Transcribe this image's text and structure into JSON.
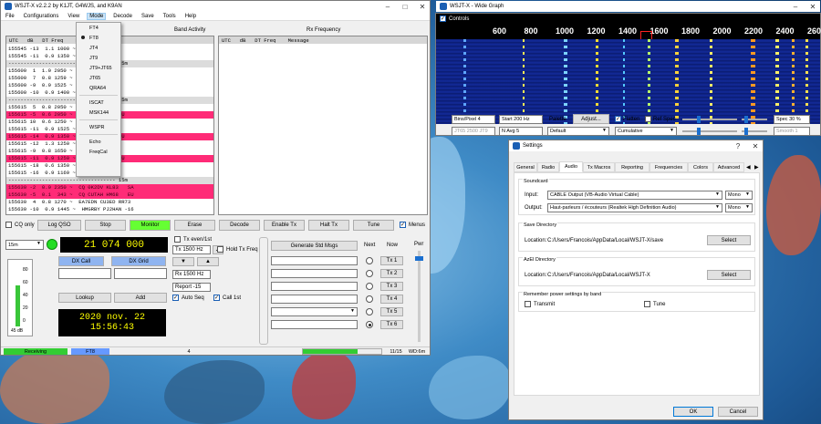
{
  "colors": {
    "cq_highlight": "#ff2b77",
    "monitor_on": "#66ff33",
    "freq_text": "#ffff00",
    "receiving": "#33cc33",
    "mode_badge": "#6699ff"
  },
  "main": {
    "title": "WSJT-X   v2.2.2   by K1JT, G4WJS, and K9AN",
    "menu": [
      "File",
      "Configurations",
      "View",
      "Mode",
      "Decode",
      "Save",
      "Tools",
      "Help"
    ],
    "band_activity_label": "Band Activity",
    "rx_frequency_label": "Rx Frequency",
    "col_header": "UTC   dB   DT Freq    Message",
    "rows": [
      {
        "t": "155545 -13  1.1 1000 ~  TS5OY -11",
        "k": "n"
      },
      {
        "t": "155545 -11  0.9 1350 ~  KA4ACH -15",
        "k": "n"
      },
      {
        "t": "----------------------------------- 15m",
        "k": "sep"
      },
      {
        "t": "155600  1  1.0 2050 ~  HSRSV RR73",
        "k": "n"
      },
      {
        "t": "155600  7  0.8 1259 ~  CU3ED -14",
        "k": "n"
      },
      {
        "t": "155600 -9  0.9 1525 ~  ZJMAN RR73",
        "k": "n"
      },
      {
        "t": "155600 -10  0.9 1400 ~  NGSW RR73",
        "k": "n"
      },
      {
        "t": "----------------------------------- 15m",
        "k": "sep"
      },
      {
        "t": "155615  5  0.8 2050 ~  OG5FI R-13",
        "k": "n"
      },
      {
        "t": "155615 -5  0.6 2050 ~  CQ FK34      EU",
        "k": "cq"
      },
      {
        "t": "155615 10  0.6 1250 ~  CU3ED -14",
        "k": "n"
      },
      {
        "t": "155615 -11  0.9 1525 ~  ZJMAN RR73",
        "k": "n"
      },
      {
        "t": "155615 -14  0.9 1350 ~  CQ IZ8E     EU",
        "k": "cq"
      },
      {
        "t": "155615 -12  1.3 1250 ~  F4JF R-10",
        "k": "n"
      },
      {
        "t": "155615 -9  0.8 1650 ~  PU1JDU -17",
        "k": "n"
      },
      {
        "t": "155615 -11  0.9 1250 ~  CQ 0052     EU",
        "k": "cq"
      },
      {
        "t": "155615 -18  0.6 1350 ~  PY2KC GG64",
        "k": "n"
      },
      {
        "t": "155615 -16  0.9 1169 ~  PU5XRV GG54",
        "k": "n"
      },
      {
        "t": "----------------------------------- 15m",
        "k": "sep"
      },
      {
        "t": "155630 -2  0.9 2350 ~  CQ 0K2DV KL83   SA",
        "k": "cq"
      },
      {
        "t": "155630 -5  0.1  343 ~  CQ CUTAH HM68   EU",
        "k": "cq"
      },
      {
        "t": "155630  4  0.8 1270 ~  EA7EDN CU3ED RR73",
        "k": "n"
      },
      {
        "t": "155630 -10  0.9 1445 ~  HMGRBY PJ2HAN -16",
        "k": "n"
      }
    ],
    "mode_menu": [
      {
        "label": "FT4",
        "selected": false
      },
      {
        "label": "FT8",
        "selected": true
      },
      {
        "label": "JT4",
        "selected": false
      },
      {
        "label": "JT9",
        "selected": false
      },
      {
        "label": "JT9+JT65",
        "selected": false
      },
      {
        "label": "JT65",
        "selected": false
      },
      {
        "label": "QRA64",
        "selected": false
      },
      {
        "label": "ISCAT",
        "selected": false
      },
      {
        "label": "MSK144",
        "selected": false
      },
      {
        "label": "WSPR",
        "selected": false
      },
      {
        "label": "Echo",
        "selected": false
      },
      {
        "label": "FreqCal",
        "selected": false
      }
    ],
    "buttons": {
      "cq_only": "CQ only",
      "log_qso": "Log QSO",
      "stop": "Stop",
      "monitor": "Monitor",
      "erase": "Erase",
      "decode": "Decode",
      "enable_tx": "Enable Tx",
      "halt_tx": "Halt Tx",
      "tune": "Tune",
      "menus": "Menus",
      "dx_call": "DX Call",
      "dx_grid": "DX Grid",
      "lookup": "Lookup",
      "add": "Add",
      "generate_std": "Generate Std Msgs",
      "next": "Next",
      "now": "Now",
      "pwr": "Pwr"
    },
    "band": "15m",
    "frequency": "21 074 000",
    "tx_even": "Tx even/1st",
    "hold_tx_freq": "Hold Tx Freq",
    "tx_hz": "Tx  1500 Hz",
    "rx_hz": "Rx  1500 Hz",
    "report": "Report -15",
    "auto_seq": "Auto Seq",
    "call_1st": "Call 1st",
    "date": "2020 nov. 22",
    "time": "15:56:43",
    "meter_scale": [
      "80",
      "60",
      "40",
      "20",
      "0"
    ],
    "meter_db": "45 dB",
    "tx_labels": [
      "Tx 1",
      "Tx 2",
      "Tx 3",
      "Tx 4",
      "Tx 5",
      "Tx 6"
    ],
    "status": {
      "state": "Receiving",
      "mode": "FT8",
      "num": "4",
      "counter": "11/15",
      "wd": "WD:6m"
    }
  },
  "wide": {
    "title": "WSJT-X - Wide Graph",
    "controls": "Controls",
    "scale": [
      "600",
      "800",
      "1000",
      "1200",
      "1400",
      "1600",
      "1800",
      "2000",
      "2200",
      "2400",
      "2600"
    ],
    "bins": "Bins/Pixel  4",
    "start": "Start 200 Hz",
    "palette": "Palette",
    "adjust": "Adjust...",
    "flatten": "Flatten",
    "ref_spec": "Ref Spec",
    "spec": "Spec 30 %",
    "jt65": "JT65  2500  JT9",
    "navg": "N Avg 5",
    "default": "Default",
    "cumulative": "Cumulative",
    "smooth": "Smooth  1"
  },
  "settings": {
    "title": "Settings",
    "tabs": [
      "General",
      "Radio",
      "Audio",
      "Tx Macros",
      "Reporting",
      "Frequencies",
      "Colors",
      "Advanced"
    ],
    "active_tab": "Audio",
    "soundcard": "Soundcard",
    "input_label": "Input:",
    "input_value": "CABLE Output (VB-Audio Virtual Cable)",
    "input_mode": "Mono",
    "output_label": "Output:",
    "output_value": "Haut-parleurs / écouteurs (Realtek High Definition Audio)",
    "output_mode": "Mono",
    "save_dir": "Save Directory",
    "save_loc_label": "Location:",
    "save_loc": "C:/Users/Francois/AppData/Local/WSJT-X/save",
    "select": "Select",
    "adif_dir": "AzEl Directory",
    "adif_loc": "C:/Users/Francois/AppData/Local/WSJT-X",
    "remember": "Remember power settings by band",
    "transmit": "Transmit",
    "tune": "Tune",
    "ok": "OK",
    "cancel": "Cancel"
  }
}
